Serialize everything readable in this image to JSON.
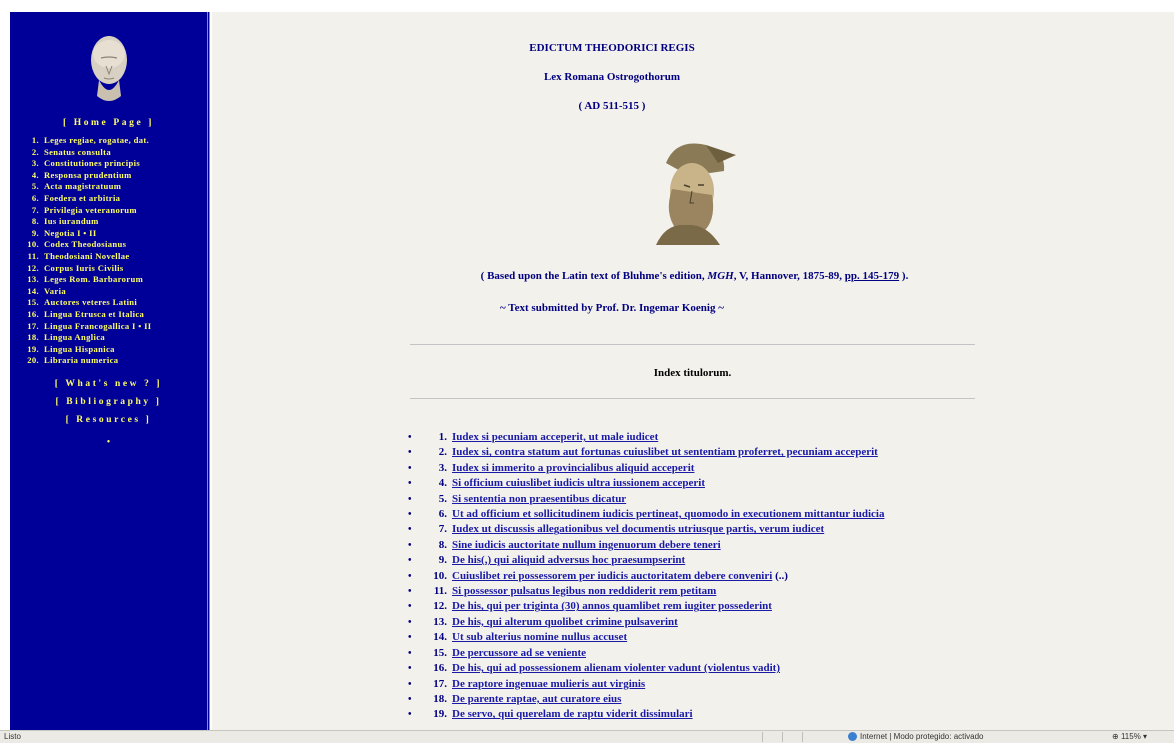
{
  "sidebar": {
    "home": "[ Home Page ]",
    "items": [
      {
        "num": "1.",
        "label": "Leges regiae, rogatae, dat."
      },
      {
        "num": "2.",
        "label": "Senatus consulta"
      },
      {
        "num": "3.",
        "label": "Constitutiones principis"
      },
      {
        "num": "4.",
        "label": "Responsa prudentium"
      },
      {
        "num": "5.",
        "label": "Acta magistratuum"
      },
      {
        "num": "6.",
        "label": "Foedera et arbitria"
      },
      {
        "num": "7.",
        "label": "Privilegia veteranorum"
      },
      {
        "num": "8.",
        "label": "Ius iurandum"
      },
      {
        "num": "9.",
        "label": "Negotia I • II"
      },
      {
        "num": "10.",
        "label": "Codex Theodosianus"
      },
      {
        "num": "11.",
        "label": "Theodosiani Novellae"
      },
      {
        "num": "12.",
        "label": "Corpus Iuris Civilis"
      },
      {
        "num": "13.",
        "label": "Leges Rom. Barbarorum"
      },
      {
        "num": "14.",
        "label": "Varia"
      },
      {
        "num": "15.",
        "label": "Auctores veteres Latini"
      },
      {
        "num": "16.",
        "label": "Lingua Etrusca et Italica"
      },
      {
        "num": "17.",
        "label": "Lingua Francogallica I • II"
      },
      {
        "num": "18.",
        "label": "Lingua Anglica"
      },
      {
        "num": "19.",
        "label": "Lingua Hispanica"
      },
      {
        "num": "20.",
        "label": "Libraria numerica"
      }
    ],
    "whats_new": "[ What's new ? ]",
    "bibliography": "[ Bibliography ]",
    "resources": "[ Resources ]",
    "dot": "•"
  },
  "main": {
    "title": "EDICTUM THEODORICI REGIS",
    "subtitle": "Lex Romana Ostrogothorum",
    "date": "( AD 511-515 )",
    "based_pre": "( Based upon the Latin text of Bluhme's edition, ",
    "based_mgh": "MGH",
    "based_mid": ", V, Hannover, 1875-89, ",
    "based_link": "pp. 145-179",
    "based_post": " ).",
    "submitted": "~  Text submitted by Prof. Dr. Ingemar Koenig  ~",
    "index_title": "Index titulorum.",
    "toc": [
      {
        "num": "1.",
        "text": "Iudex si pecuniam acceperit, ut male iudicet",
        "suffix": ""
      },
      {
        "num": "2.",
        "text": "Iudex si, contra statum aut fortunas cuiuslibet ut sententiam proferret, pecuniam acceperit",
        "suffix": ""
      },
      {
        "num": "3.",
        "text": "Iudex si immerito a provincialibus aliquid acceperit",
        "suffix": ""
      },
      {
        "num": "4.",
        "text": "Si officium cuiuslibet iudicis ultra iussionem acceperit",
        "suffix": ""
      },
      {
        "num": "5.",
        "text": "Si sententia non praesentibus dicatur",
        "suffix": ""
      },
      {
        "num": "6.",
        "text": "Ut ad officium et sollicitudinem iudicis pertineat, quomodo in executionem mittantur iudicia",
        "suffix": ""
      },
      {
        "num": "7.",
        "text": "Iudex ut discussis allegationibus vel documentis utriusque partis, verum iudicet",
        "suffix": ""
      },
      {
        "num": "8.",
        "text": "Sine iudicis auctoritate nullum ingenuorum debere teneri",
        "suffix": ""
      },
      {
        "num": "9.",
        "text": "De his(,) qui aliquid adversus hoc praesumpserint",
        "suffix": ""
      },
      {
        "num": "10.",
        "text": "Cuiuslibet rei possessorem per iudicis auctoritatem debere conveniri",
        "suffix": " (..)"
      },
      {
        "num": "11.",
        "text": "Si possessor pulsatus legibus non reddiderit rem petitam",
        "suffix": ""
      },
      {
        "num": "12.",
        "text": "De his, qui per triginta (30) annos quamlibet rem iugiter possederint",
        "suffix": ""
      },
      {
        "num": "13.",
        "text": "De his, qui alterum quolibet crimine pulsaverint",
        "suffix": ""
      },
      {
        "num": "14.",
        "text": "Ut sub alterius nomine nullus accuset",
        "suffix": ""
      },
      {
        "num": "15.",
        "text": "De percussore ad se veniente",
        "suffix": ""
      },
      {
        "num": "16.",
        "text": "De his, qui ad possessionem alienam violenter vadunt (violentus vadit)",
        "suffix": ""
      },
      {
        "num": "17.",
        "text": "De raptore ingenuae mulieris aut virginis",
        "suffix": ""
      },
      {
        "num": "18.",
        "text": "De parente raptae, aut curatore eius",
        "suffix": ""
      },
      {
        "num": "19.",
        "text": "De servo, qui querelam de raptu viderit dissimulari",
        "suffix": ""
      }
    ]
  },
  "statusbar": {
    "left": "Listo",
    "zone": "Internet | Modo protegido: activado",
    "zoom": "115%"
  },
  "colors": {
    "sidebar_bg": "#000099",
    "sidebar_text": "#ffff66",
    "link": "#1a1aa6",
    "heading": "#000080",
    "page_bg": "#f3f1ec"
  }
}
